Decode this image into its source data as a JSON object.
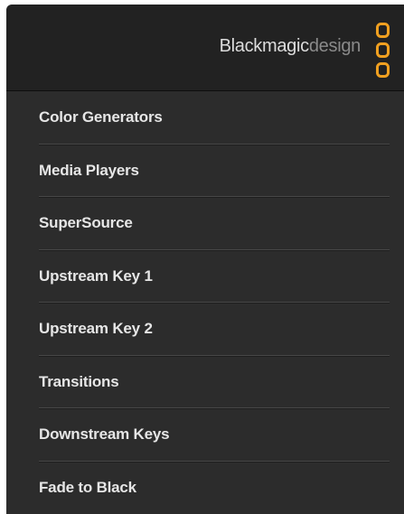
{
  "header": {
    "brand_strong": "Blackmagic",
    "brand_light": "design",
    "accent_color": "#f0a020"
  },
  "menu": {
    "items": [
      {
        "label": "Color Generators"
      },
      {
        "label": "Media Players"
      },
      {
        "label": "SuperSource"
      },
      {
        "label": "Upstream Key 1"
      },
      {
        "label": "Upstream Key 2"
      },
      {
        "label": "Transitions"
      },
      {
        "label": "Downstream Keys"
      },
      {
        "label": "Fade to Black"
      }
    ]
  },
  "colors": {
    "header_background": "#222222",
    "menu_background": "#2c2c2c",
    "menu_text": "#e6e6e6",
    "separator": "#474747"
  }
}
